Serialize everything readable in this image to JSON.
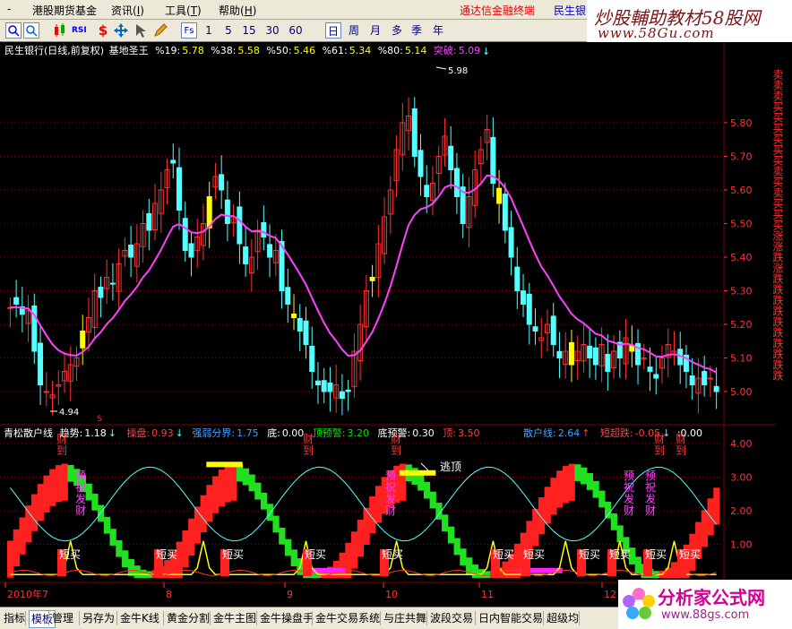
{
  "menu": {
    "items": [
      "港股期货基金",
      "资讯",
      "工具",
      "帮助"
    ],
    "hotlink": "通达信金融终端",
    "stock_short": "民生银"
  },
  "toolbar": {
    "periods": [
      "1",
      "5",
      "15",
      "30",
      "60",
      "日",
      "周",
      "月",
      "多",
      "季",
      "年"
    ],
    "selected_period": "日",
    "icons": [
      "K",
      "RSI",
      "$"
    ],
    "fs_label": "Fs"
  },
  "brand": {
    "line1": "炒股輔助教材58股网",
    "line2": "www.58Gu.com"
  },
  "main_chart": {
    "header": {
      "name": "民生银行(日线,前复权)",
      "indicator": "基地圣王",
      "pcts": [
        {
          "label": "%19:",
          "value": "5.78"
        },
        {
          "label": "%38:",
          "value": "5.58"
        },
        {
          "label": "%50:",
          "value": "5.46"
        },
        {
          "label": "%61:",
          "value": "5.34"
        },
        {
          "label": "%80:",
          "value": "5.14"
        }
      ],
      "breakout_label": "突破:",
      "breakout_value": "5.09"
    },
    "y_ticks": [
      "5.80",
      "5.70",
      "5.60",
      "5.50",
      "5.40",
      "5.30",
      "5.20",
      "5.10",
      "5.00"
    ],
    "high_label": "5.98",
    "low_label": "4.94",
    "side_text": "卖卖卖买买买买买买卖买卖买买买涨涨跌涨跌跌跌跌跌跌跌跌跌跌"
  },
  "sub_chart": {
    "header": {
      "name": "青松散户线",
      "items": [
        {
          "label": "趋势:",
          "value": "1.18",
          "color": "#ffffff"
        },
        {
          "label": "操盘:",
          "value": "0.93",
          "color": "#ff4040"
        },
        {
          "label": "强弱分界:",
          "value": "1.75",
          "color": "#40a0ff"
        },
        {
          "label": "底:",
          "value": "0.00",
          "color": "#ffffff"
        },
        {
          "label": "顶预警:",
          "value": "3.20",
          "color": "#00e000"
        },
        {
          "label": "底预警:",
          "value": "0.30",
          "color": "#ffffff"
        },
        {
          "label": "顶:",
          "value": "3.50",
          "color": "#ff4040"
        },
        {
          "label": "散户线:",
          "value": "2.64",
          "color": "#40a0ff"
        },
        {
          "label": "短超跌:",
          "value": "-0.05",
          "color": "#ff4040"
        },
        {
          "label": "",
          "value": ":0.00",
          "color": "#ffffff"
        }
      ]
    },
    "y_ticks": [
      "4.00",
      "3.00",
      "2.00",
      "1.00"
    ],
    "labels": {
      "profit": "财到",
      "warn": "预祝发财",
      "escape": "逃顶",
      "short_buy": "短买"
    }
  },
  "x_axis": {
    "labels": [
      "2010年7",
      "8",
      "9",
      "10",
      "11",
      "12"
    ]
  },
  "tabs": [
    "指标",
    "模板",
    "管理",
    "另存为",
    "金牛K线",
    "黄金分割",
    "金牛主图",
    "金牛操盘手",
    "金牛交易系统",
    "与庄共舞",
    "波段交易",
    "日内智能交易",
    "超级均"
  ],
  "active_tab": "模板",
  "footer_brand": {
    "title": "分析家公式网",
    "url": "www.88gs.com"
  },
  "colors": {
    "up": "#ff3232",
    "down": "#54ffff",
    "ma": "#ff40ff",
    "price_axis": "#ff3232",
    "grid": "#7f0000"
  }
}
